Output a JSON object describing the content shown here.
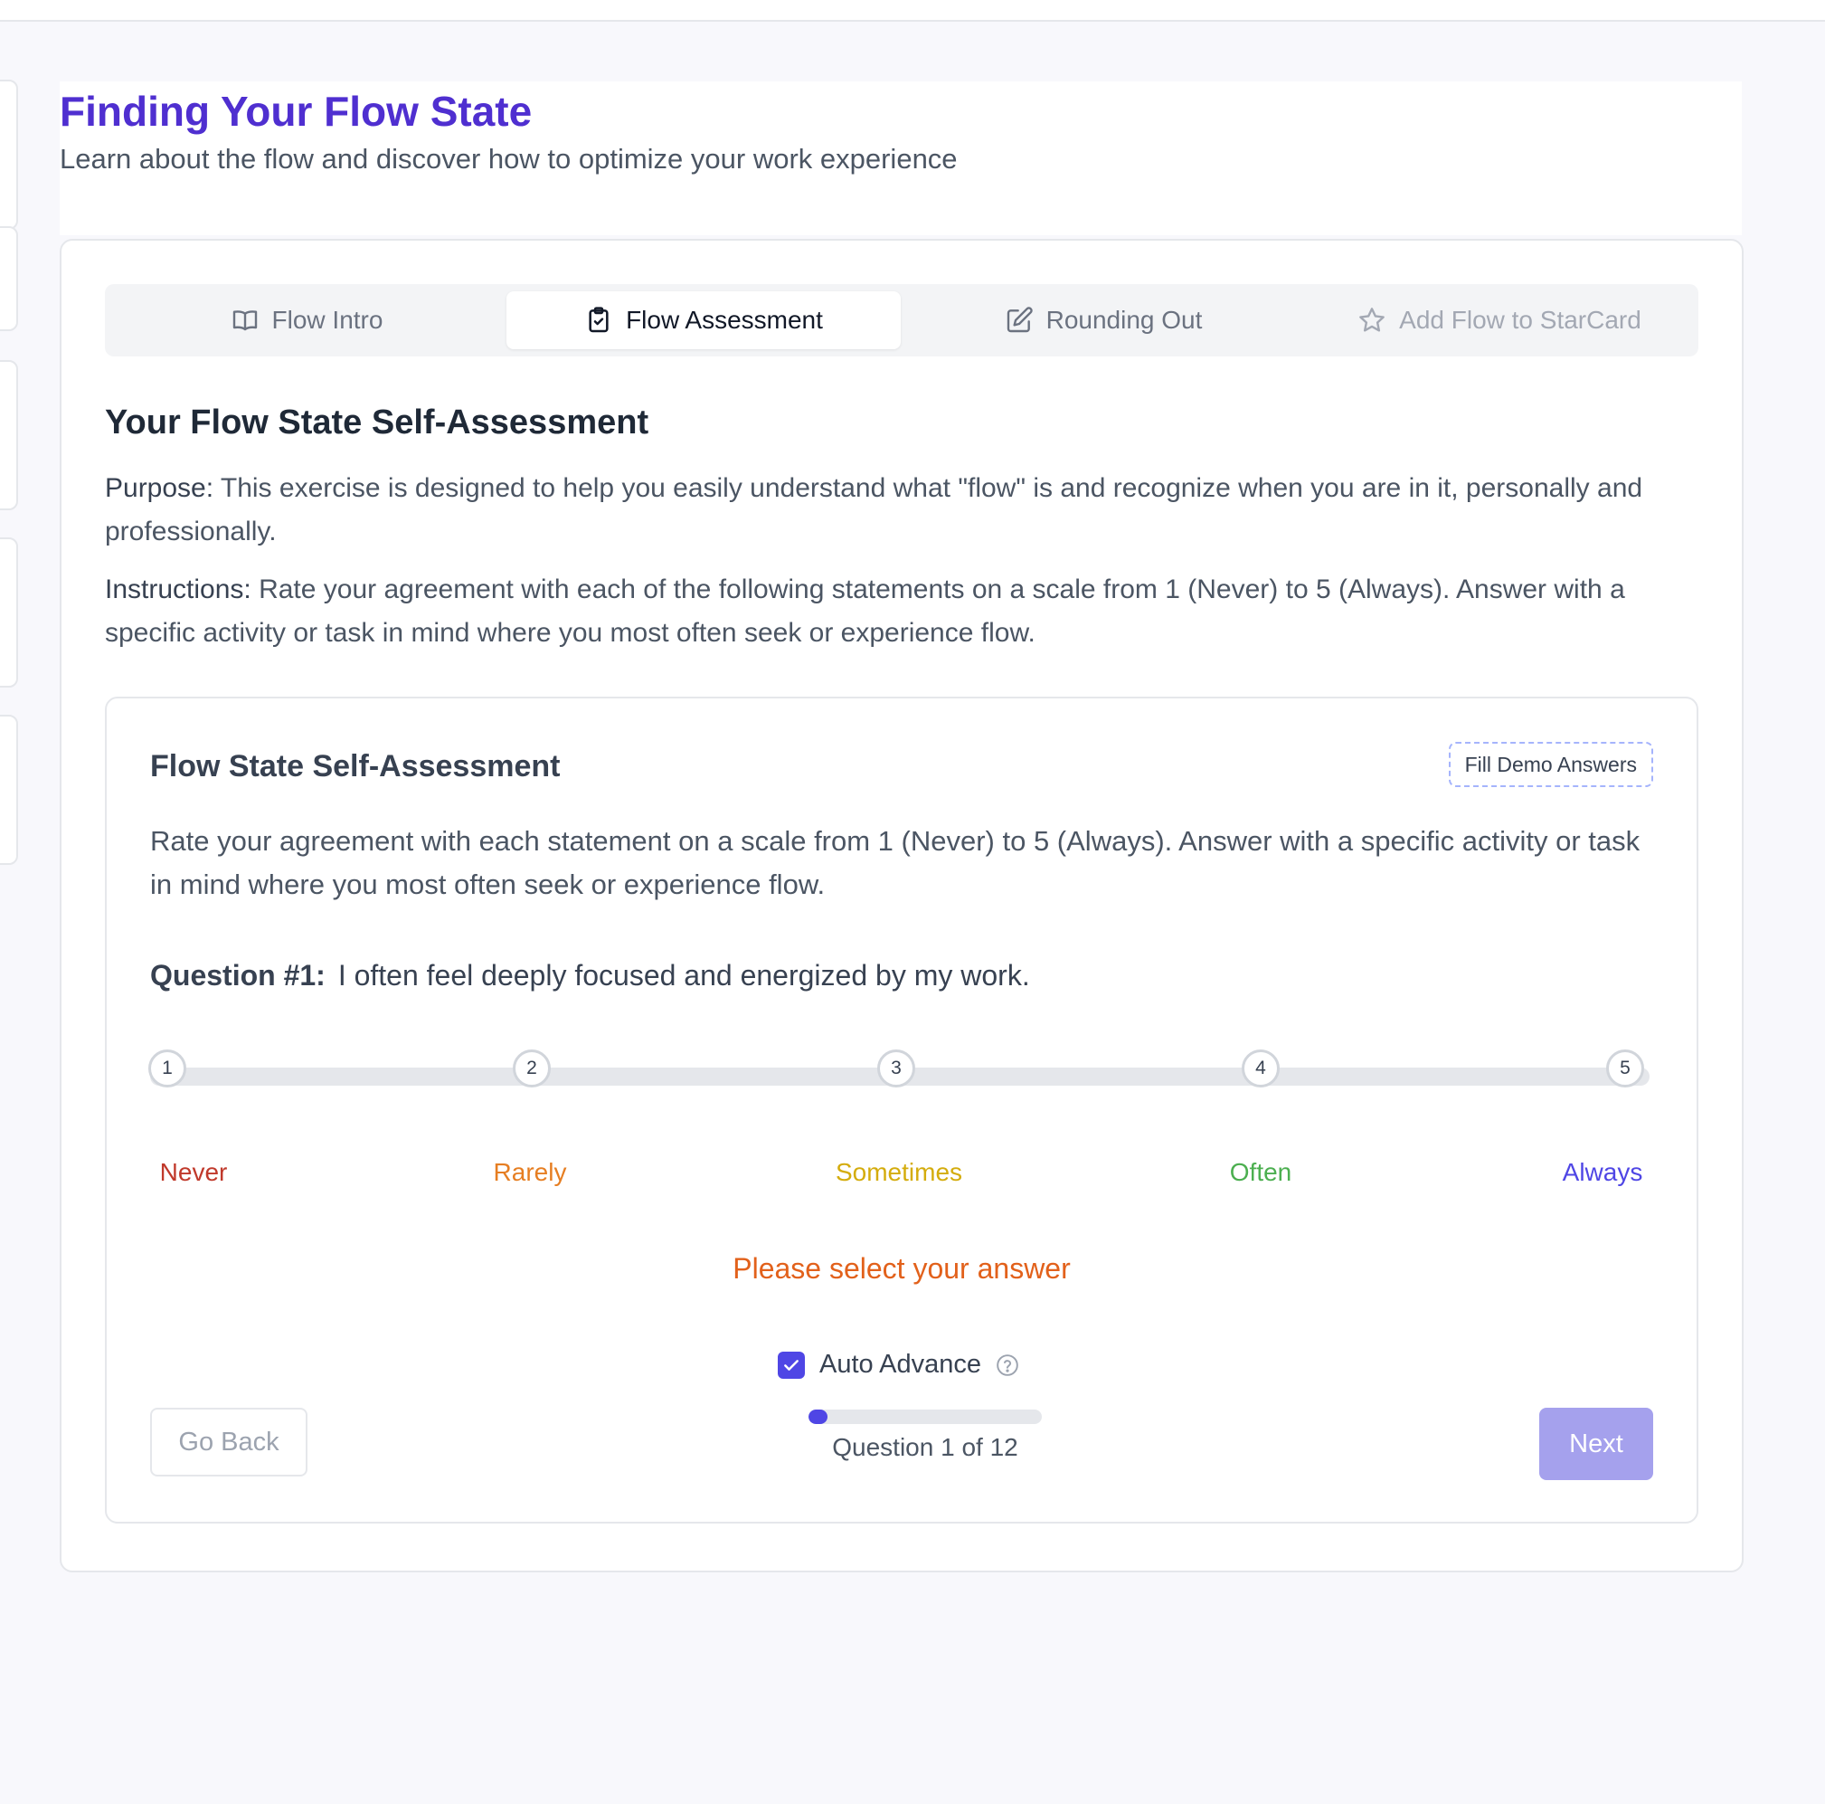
{
  "header": {
    "title": "Finding Your Flow State",
    "subtitle": "Learn about the flow and discover how to optimize your work experience"
  },
  "tabs": [
    {
      "label": "Flow Intro",
      "icon": "book-open-icon",
      "state": "inactive"
    },
    {
      "label": "Flow Assessment",
      "icon": "clipboard-check-icon",
      "state": "active"
    },
    {
      "label": "Rounding Out",
      "icon": "pencil-square-icon",
      "state": "inactive"
    },
    {
      "label": "Add Flow to StarCard",
      "icon": "star-icon",
      "state": "disabled"
    }
  ],
  "section": {
    "title": "Your Flow State Self-Assessment",
    "purpose_label": "Purpose:",
    "purpose_text": " This exercise is designed to help you easily understand what \"flow\" is and recognize when you are in it, personally and professionally.",
    "instructions_label": "Instructions:",
    "instructions_text": " Rate your agreement with each of the following statements on a scale from 1 (Never) to 5 (Always). Answer with a specific activity or task in mind where you most often seek or experience flow."
  },
  "assessment": {
    "title": "Flow State Self-Assessment",
    "demo_button": "Fill Demo Answers",
    "description": "Rate your agreement with each statement on a scale from 1 (Never) to 5 (Always). Answer with a specific activity or task in mind where you most often seek or experience flow.",
    "question_label": "Question #1:",
    "question_text": "I often feel deeply focused and energized by my work.",
    "scale": [
      {
        "value": "1",
        "label": "Never",
        "color": "#c0392b"
      },
      {
        "value": "2",
        "label": "Rarely",
        "color": "#e67e22"
      },
      {
        "value": "3",
        "label": "Sometimes",
        "color": "#d4ac0d"
      },
      {
        "value": "4",
        "label": "Often",
        "color": "#4caf50"
      },
      {
        "value": "5",
        "label": "Always",
        "color": "#4f46e5"
      }
    ],
    "prompt": "Please select your answer",
    "auto_advance_label": "Auto Advance",
    "auto_advance_checked": true,
    "back_button": "Go Back",
    "next_button": "Next",
    "progress_text": "Question 1 of 12",
    "progress_fraction": 0.0833
  },
  "colors": {
    "accent": "#4f46e5",
    "title": "#4f2fd0",
    "prompt": "#e2611b"
  }
}
